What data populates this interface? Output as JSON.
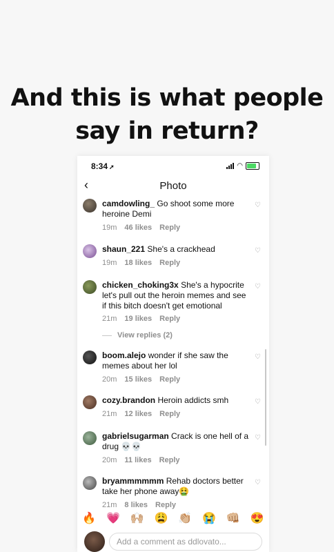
{
  "headline": {
    "line1": "And this is what people",
    "line2": "say in return?"
  },
  "status": {
    "time": "8:34",
    "location_icon": "location-arrow-icon"
  },
  "nav": {
    "back_icon": "chevron-left-icon",
    "title": "Photo"
  },
  "comments": [
    {
      "user": "camdowling_",
      "text": "Go shoot some more heroine Demi",
      "time": "19m",
      "likes": "46 likes",
      "reply": "Reply"
    },
    {
      "user": "shaun_221",
      "text": "She's a crackhead",
      "time": "19m",
      "likes": "18 likes",
      "reply": "Reply"
    },
    {
      "user": "chicken_choking3x",
      "text": "She's a hypocrite let's pull out the heroin memes and see if this bitch doesn't get emotional",
      "time": "21m",
      "likes": "19 likes",
      "reply": "Reply"
    },
    {
      "user": "boom.alejo",
      "text": "wonder if she saw the memes about her lol",
      "time": "20m",
      "likes": "15 likes",
      "reply": "Reply"
    },
    {
      "user": "cozy.brandon",
      "text": "Heroin addicts smh",
      "time": "21m",
      "likes": "12 likes",
      "reply": "Reply"
    },
    {
      "user": "gabrielsugarman",
      "text": "Crack is one hell of a drug 💀💀",
      "time": "20m",
      "likes": "11 likes",
      "reply": "Reply"
    },
    {
      "user": "bryammmmmm",
      "text": "Rehab doctors better take her phone away🤮",
      "time": "21m",
      "likes": "8 likes",
      "reply": "Reply"
    }
  ],
  "view_replies": "View replies (2)",
  "emojis": [
    "🔥",
    "💗",
    "🙌🏼",
    "😩",
    "👏🏼",
    "😭",
    "👊🏼",
    "😍"
  ],
  "composer": {
    "placeholder": "Add a comment as ddlovato..."
  }
}
